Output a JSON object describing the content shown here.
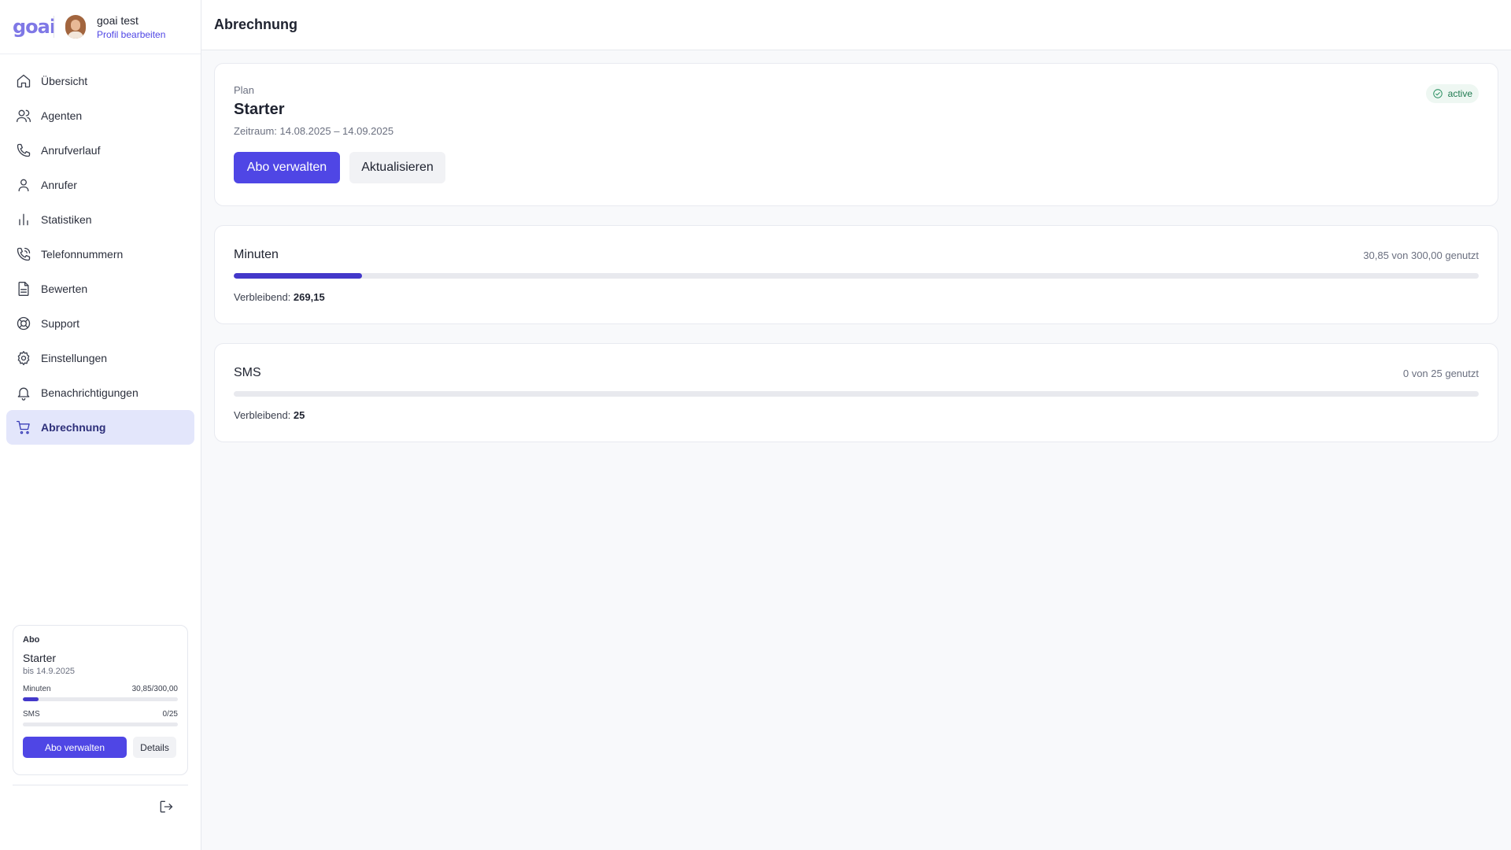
{
  "sidebar": {
    "logo": "goai",
    "user": {
      "name": "goai test",
      "edit_link": "Profil bearbeiten"
    },
    "items": [
      {
        "label": "Übersicht",
        "icon": "home-icon"
      },
      {
        "label": "Agenten",
        "icon": "users-icon"
      },
      {
        "label": "Anrufverlauf",
        "icon": "phone-icon"
      },
      {
        "label": "Anrufer",
        "icon": "user-icon"
      },
      {
        "label": "Statistiken",
        "icon": "bar-chart-icon"
      },
      {
        "label": "Telefonnummern",
        "icon": "phone-forward-icon"
      },
      {
        "label": "Bewerten",
        "icon": "document-icon"
      },
      {
        "label": "Support",
        "icon": "lifebuoy-icon"
      },
      {
        "label": "Einstellungen",
        "icon": "gear-icon"
      },
      {
        "label": "Benachrichtigungen",
        "icon": "bell-icon"
      },
      {
        "label": "Abrechnung",
        "icon": "cart-icon",
        "active": true
      }
    ],
    "subscription": {
      "title": "Abo",
      "plan": "Starter",
      "until": "bis 14.9.2025",
      "minutes_label": "Minuten",
      "minutes_value": "30,85/300,00",
      "minutes_fraction": 0.103,
      "sms_label": "SMS",
      "sms_value": "0/25",
      "sms_fraction": 0,
      "manage_button": "Abo verwalten",
      "details_button": "Details"
    }
  },
  "header": {
    "title": "Abrechnung"
  },
  "plan": {
    "label": "Plan",
    "name": "Starter",
    "period": "Zeitraum: 14.08.2025 – 14.09.2025",
    "status": "active",
    "manage_button": "Abo verwalten",
    "refresh_button": "Aktualisieren"
  },
  "usage": {
    "minutes": {
      "title": "Minuten",
      "count": "30,85 von 300,00 genutzt",
      "fraction": 0.103,
      "remaining_label": "Verbleibend:",
      "remaining_value": "269,15"
    },
    "sms": {
      "title": "SMS",
      "count": "0 von 25 genutzt",
      "fraction": 0,
      "remaining_label": "Verbleibend:",
      "remaining_value": "25"
    }
  },
  "colors": {
    "accent": "#4f46e5",
    "progress": "#4338ca",
    "active_nav_bg": "#e3e6fb",
    "status_green": "#1f8a5a"
  }
}
